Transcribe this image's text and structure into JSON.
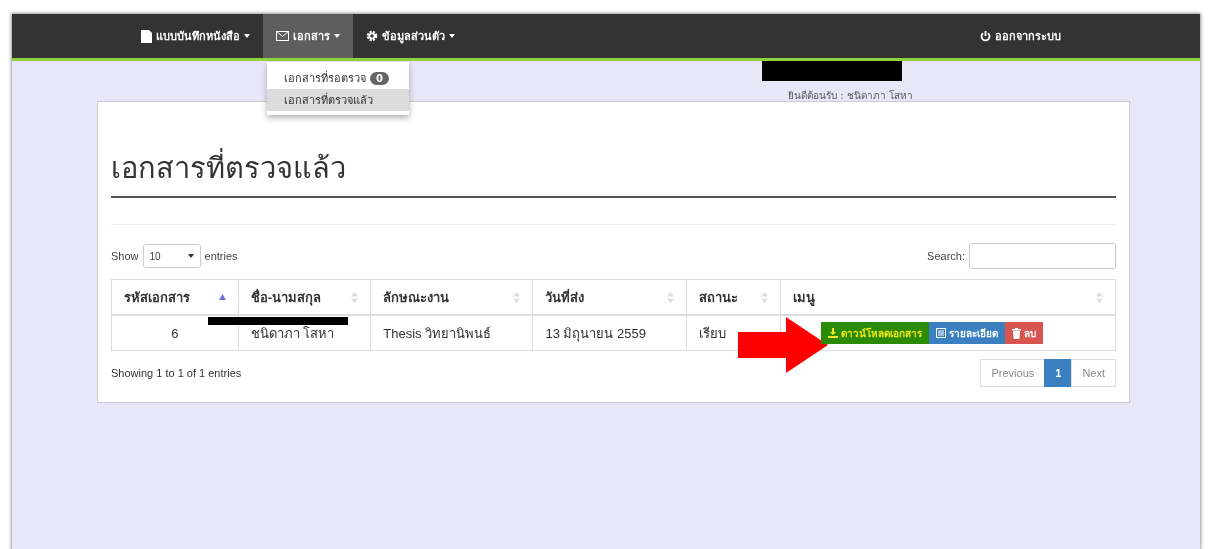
{
  "navbar": {
    "items": [
      {
        "label": "แบบบันทึกหนังสือ",
        "selected": false
      },
      {
        "label": "เอกสาร",
        "selected": true
      },
      {
        "label": "ข้อมูลส่วนตัว",
        "selected": false
      }
    ],
    "logout": {
      "label": "ออกจากระบบ"
    }
  },
  "dropdown": {
    "items": [
      {
        "label": "เอกสารที่รอตรวจ",
        "badge": "0",
        "selected": false
      },
      {
        "label": "เอกสารที่ตรวจแล้ว",
        "selected": true
      }
    ]
  },
  "welcome": "ยินดีต้อนรับ : ชนิดาภา โสหา",
  "page_title": "เอกสารที่ตรวจแล้ว",
  "table_controls": {
    "show_label": "Show",
    "page_size": "10",
    "entries_label": "entries",
    "search_label": "Search:"
  },
  "table": {
    "columns": [
      {
        "label": "รหัสเอกสาร",
        "sorted": true
      },
      {
        "label": "ชื่อ-นามสกุล",
        "sorted": false
      },
      {
        "label": "ลักษณะงาน",
        "sorted": false
      },
      {
        "label": "วันที่ส่ง",
        "sorted": false
      },
      {
        "label": "สถานะ",
        "sorted": false
      },
      {
        "label": "เมนู",
        "sorted": false
      }
    ],
    "rows": [
      {
        "id": "6",
        "name": "ชนิดาภา โสหา",
        "type": "Thesis วิทยานิพนธ์",
        "date": "13 มิถุนายน 2559",
        "status": "เรียบ",
        "actions": [
          {
            "kind": "download",
            "label": "ดาวน์โหลดเอกสาร"
          },
          {
            "kind": "details",
            "label": "รายละเอียด"
          },
          {
            "kind": "delete",
            "label": "ลบ"
          }
        ]
      }
    ]
  },
  "info": "Showing 1 to 1 of 1 entries",
  "pagination": [
    {
      "label": "Previous",
      "selected": false
    },
    {
      "label": "1",
      "selected": true
    },
    {
      "label": "Next",
      "selected": false
    }
  ]
}
